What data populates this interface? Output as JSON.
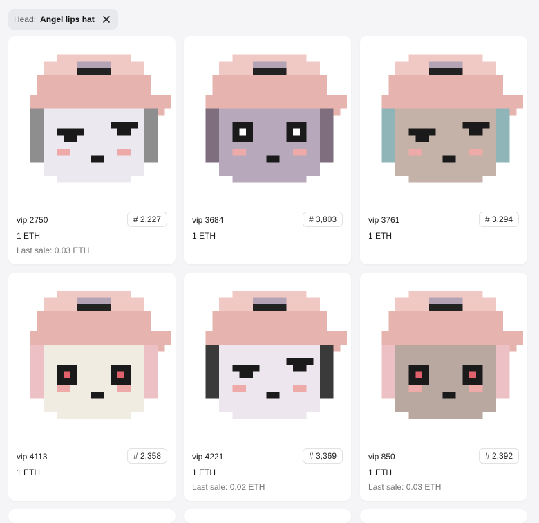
{
  "filter": {
    "key": "Head:",
    "value": "Angel lips hat",
    "remove_icon": "close-icon"
  },
  "items": [
    {
      "name": "vip 2750",
      "rank": "# 2,227",
      "price": "1 ETH",
      "last_sale": "Last sale: 0.03 ETH",
      "skin": "#ece8f0",
      "hair": "#8e8e8e",
      "eyes": "sleepy"
    },
    {
      "name": "vip 3684",
      "rank": "# 3,803",
      "price": "1 ETH",
      "last_sale": "",
      "skin": "#b8a8bc",
      "hair": "#7e6e7e",
      "eyes": "round"
    },
    {
      "name": "vip 3761",
      "rank": "# 3,294",
      "price": "1 ETH",
      "last_sale": "",
      "skin": "#c4b2a8",
      "hair": "#8fb5b8",
      "eyes": "sleepy"
    },
    {
      "name": "vip 4113",
      "rank": "# 2,358",
      "price": "1 ETH",
      "last_sale": "",
      "skin": "#f1ece2",
      "hair": "#ecc0c4",
      "eyes": "heart"
    },
    {
      "name": "vip 4221",
      "rank": "# 3,369",
      "price": "1 ETH",
      "last_sale": "Last sale: 0.02 ETH",
      "skin": "#ede6ee",
      "hair": "#3a3a3a",
      "eyes": "sleepy"
    },
    {
      "name": "vip 850",
      "rank": "# 2,392",
      "price": "1 ETH",
      "last_sale": "Last sale: 0.03 ETH",
      "skin": "#b8a8a0",
      "hair": "#ecc0c4",
      "eyes": "heart"
    }
  ],
  "colors": {
    "hat": "#e6b3ae",
    "hat_light": "#f0c9c4",
    "lips": "#b3a3b5",
    "lips_line": "#222222"
  }
}
